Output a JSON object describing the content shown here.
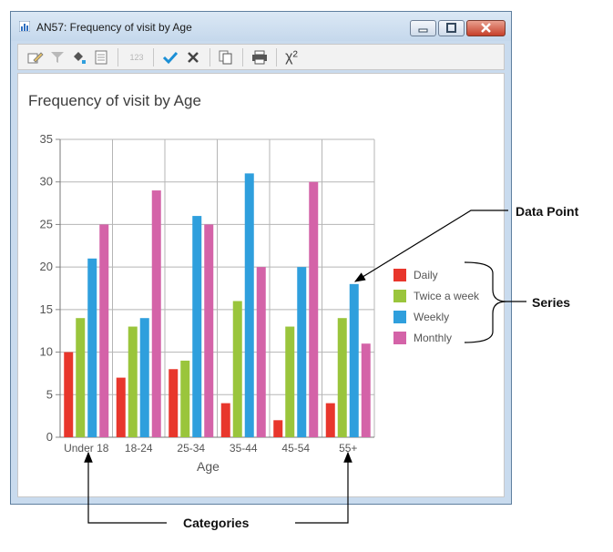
{
  "window": {
    "title": "AN57: Frequency of visit by Age"
  },
  "toolbar": {
    "icons": [
      "edit-icon",
      "filter-icon",
      "fill-icon",
      "document-icon",
      "number-format-icon",
      "check-icon",
      "cross-icon",
      "copy-icon",
      "print-icon",
      "chi-square-icon"
    ],
    "number_label": "123",
    "chi_label": "χ²"
  },
  "chart_data": {
    "type": "bar",
    "title": "Frequency of visit by Age",
    "xlabel": "Age",
    "ylabel": "",
    "ylim": [
      0,
      35
    ],
    "yticks": [
      "0",
      "5",
      "10",
      "15",
      "20",
      "25",
      "30",
      "35"
    ],
    "categories": [
      "Under 18",
      "18-24",
      "25-34",
      "35-44",
      "45-54",
      "55+"
    ],
    "series": [
      {
        "name": "Daily",
        "color": "#e8362c",
        "values": [
          10,
          7,
          8,
          4,
          2,
          4
        ]
      },
      {
        "name": "Twice a week",
        "color": "#9ac53c",
        "values": [
          14,
          13,
          9,
          16,
          13,
          14
        ]
      },
      {
        "name": "Weekly",
        "color": "#2f9fdd",
        "values": [
          21,
          14,
          26,
          31,
          20,
          18
        ]
      },
      {
        "name": "Monthly",
        "color": "#d463a8",
        "values": [
          25,
          29,
          25,
          20,
          30,
          11
        ]
      }
    ],
    "grid": true,
    "legend_position": "right"
  },
  "annotations": {
    "data_point": "Data Point",
    "series": "Series",
    "categories": "Categories"
  }
}
